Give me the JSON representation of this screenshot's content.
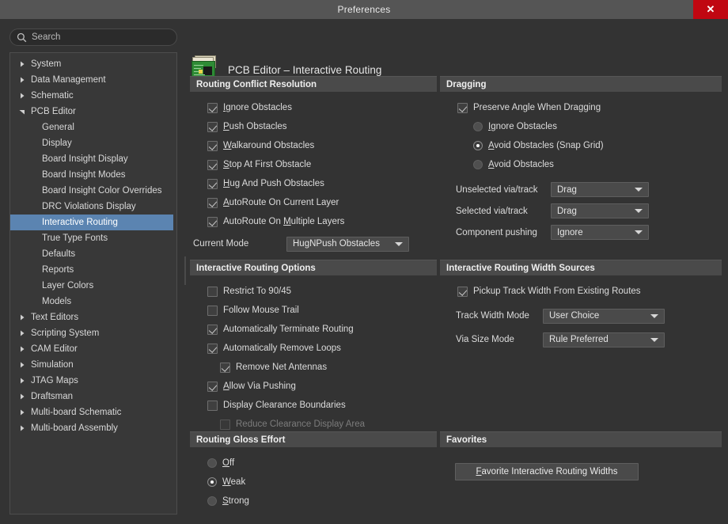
{
  "window": {
    "title": "Preferences",
    "close_label": "✕"
  },
  "search": {
    "placeholder": "Search",
    "icon": "search-icon"
  },
  "sidebar": {
    "items": [
      {
        "label": "System",
        "level": 1,
        "expander": "collapsed",
        "selected": false
      },
      {
        "label": "Data Management",
        "level": 1,
        "expander": "collapsed",
        "selected": false
      },
      {
        "label": "Schematic",
        "level": 1,
        "expander": "collapsed",
        "selected": false
      },
      {
        "label": "PCB Editor",
        "level": 1,
        "expander": "expanded",
        "selected": false
      },
      {
        "label": "General",
        "level": 2,
        "expander": "none",
        "selected": false
      },
      {
        "label": "Display",
        "level": 2,
        "expander": "none",
        "selected": false
      },
      {
        "label": "Board Insight Display",
        "level": 2,
        "expander": "none",
        "selected": false
      },
      {
        "label": "Board Insight Modes",
        "level": 2,
        "expander": "none",
        "selected": false
      },
      {
        "label": "Board Insight Color Overrides",
        "level": 2,
        "expander": "none",
        "selected": false
      },
      {
        "label": "DRC Violations Display",
        "level": 2,
        "expander": "none",
        "selected": false
      },
      {
        "label": "Interactive Routing",
        "level": 2,
        "expander": "none",
        "selected": true
      },
      {
        "label": "True Type Fonts",
        "level": 2,
        "expander": "none",
        "selected": false
      },
      {
        "label": "Defaults",
        "level": 2,
        "expander": "none",
        "selected": false
      },
      {
        "label": "Reports",
        "level": 2,
        "expander": "none",
        "selected": false
      },
      {
        "label": "Layer Colors",
        "level": 2,
        "expander": "none",
        "selected": false
      },
      {
        "label": "Models",
        "level": 2,
        "expander": "none",
        "selected": false
      },
      {
        "label": "Text Editors",
        "level": 1,
        "expander": "collapsed",
        "selected": false
      },
      {
        "label": "Scripting System",
        "level": 1,
        "expander": "collapsed",
        "selected": false
      },
      {
        "label": "CAM Editor",
        "level": 1,
        "expander": "collapsed",
        "selected": false
      },
      {
        "label": "Simulation",
        "level": 1,
        "expander": "collapsed",
        "selected": false
      },
      {
        "label": "JTAG Maps",
        "level": 1,
        "expander": "collapsed",
        "selected": false
      },
      {
        "label": "Draftsman",
        "level": 1,
        "expander": "collapsed",
        "selected": false
      },
      {
        "label": "Multi-board Schematic",
        "level": 1,
        "expander": "collapsed",
        "selected": false
      },
      {
        "label": "Multi-board Assembly",
        "level": 1,
        "expander": "collapsed",
        "selected": false
      }
    ]
  },
  "page": {
    "icon": "pcb-board-icon",
    "title": "PCB Editor – Interactive Routing"
  },
  "routing_conflict_resolution": {
    "header": "Routing Conflict Resolution",
    "checkboxes": [
      {
        "label": "Ignore Obstacles",
        "mnemonic": "I",
        "checked": true,
        "enabled": true
      },
      {
        "label": "Push Obstacles",
        "mnemonic": "P",
        "checked": true,
        "enabled": true
      },
      {
        "label": "Walkaround Obstacles",
        "mnemonic": "W",
        "checked": true,
        "enabled": true
      },
      {
        "label": "Stop At First Obstacle",
        "mnemonic": "S",
        "checked": true,
        "enabled": true
      },
      {
        "label": "Hug And Push Obstacles",
        "mnemonic": "H",
        "checked": true,
        "enabled": true
      },
      {
        "label": "AutoRoute On Current Layer",
        "mnemonic": "A",
        "checked": true,
        "enabled": true
      },
      {
        "label": "AutoRoute On Multiple Layers",
        "mnemonic": "M",
        "checked": true,
        "enabled": true
      }
    ],
    "current_mode_label": "Current Mode",
    "current_mode_value": "HugNPush Obstacles"
  },
  "interactive_routing_options": {
    "header": "Interactive Routing Options",
    "checkboxes": [
      {
        "label": "Restrict To 90/45",
        "mnemonic": "",
        "checked": false,
        "enabled": true,
        "indent": 0
      },
      {
        "label": "Follow Mouse Trail",
        "mnemonic": "",
        "checked": false,
        "enabled": true,
        "indent": 0
      },
      {
        "label": "Automatically Terminate Routing",
        "mnemonic": "",
        "checked": true,
        "enabled": true,
        "indent": 0
      },
      {
        "label": "Automatically Remove Loops",
        "mnemonic": "",
        "checked": true,
        "enabled": true,
        "indent": 0
      },
      {
        "label": "Remove Net Antennas",
        "mnemonic": "",
        "checked": true,
        "enabled": true,
        "indent": 1
      },
      {
        "label": "Allow Via Pushing",
        "mnemonic": "A",
        "checked": true,
        "enabled": true,
        "indent": 0
      },
      {
        "label": "Display Clearance Boundaries",
        "mnemonic": "",
        "checked": false,
        "enabled": true,
        "indent": 0
      },
      {
        "label": "Reduce Clearance Display Area",
        "mnemonic": "",
        "checked": false,
        "enabled": false,
        "indent": 1
      }
    ]
  },
  "routing_gloss_effort": {
    "header": "Routing Gloss Effort",
    "options": [
      {
        "label": "Off",
        "mnemonic": "O",
        "selected": false
      },
      {
        "label": "Weak",
        "mnemonic": "W",
        "selected": true
      },
      {
        "label": "Strong",
        "mnemonic": "S",
        "selected": false
      }
    ]
  },
  "dragging": {
    "header": "Dragging",
    "preserve_angle": {
      "label": "Preserve Angle When Dragging",
      "checked": true
    },
    "options": [
      {
        "label": "Ignore Obstacles",
        "mnemonic": "I",
        "selected": false
      },
      {
        "label": "Avoid Obstacles (Snap Grid)",
        "mnemonic": "A",
        "selected": true
      },
      {
        "label": "Avoid Obstacles",
        "mnemonic": "A",
        "selected": false
      }
    ],
    "fields": [
      {
        "label": "Unselected via/track",
        "value": "Drag"
      },
      {
        "label": "Selected via/track",
        "value": "Drag"
      },
      {
        "label": "Component pushing",
        "value": "Ignore"
      }
    ]
  },
  "width_sources": {
    "header": "Interactive Routing Width Sources",
    "pickup": {
      "label": "Pickup Track Width From Existing Routes",
      "checked": true
    },
    "fields": [
      {
        "label": "Track Width Mode",
        "value": "User Choice"
      },
      {
        "label": "Via Size Mode",
        "value": "Rule Preferred"
      }
    ]
  },
  "favorites": {
    "header": "Favorites",
    "button_label": "Favorite Interactive Routing Widths",
    "button_mnemonic": "F"
  },
  "colors": {
    "window_bg": "#333333",
    "titlebar_bg": "#555555",
    "close_red": "#c00711",
    "group_header_bg": "#4a4a4a",
    "selection_blue": "#5b84b1",
    "text": "#dcdcdc",
    "text_disabled": "#7c7c7c",
    "pcb_green": "#2e8b35"
  }
}
